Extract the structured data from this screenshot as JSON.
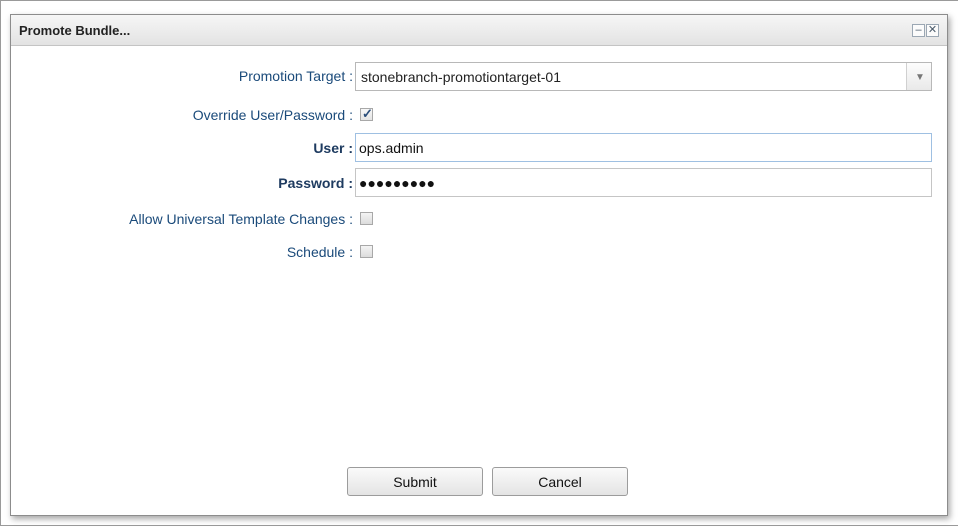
{
  "dialog": {
    "title": "Promote Bundle...",
    "minimize_glyph": "–",
    "close_glyph": "✕"
  },
  "form": {
    "promotion_target": {
      "label": "Promotion Target :",
      "value": "stonebranch-promotiontarget-01"
    },
    "override": {
      "label": "Override User/Password :",
      "checked": true
    },
    "user": {
      "label": "User :",
      "value": "ops.admin"
    },
    "password": {
      "label": "Password :",
      "value": "●●●●●●●●●"
    },
    "allow_template_changes": {
      "label": "Allow Universal Template Changes :",
      "checked": false
    },
    "schedule": {
      "label": "Schedule :",
      "checked": false
    }
  },
  "buttons": {
    "submit": "Submit",
    "cancel": "Cancel"
  },
  "colors": {
    "label": "#1a4a7a",
    "bold_label": "#1e3b60",
    "focus_border": "#9fc0e2"
  },
  "icons": {
    "dropdown": "chevron-down-icon",
    "check": "checkmark-icon"
  }
}
